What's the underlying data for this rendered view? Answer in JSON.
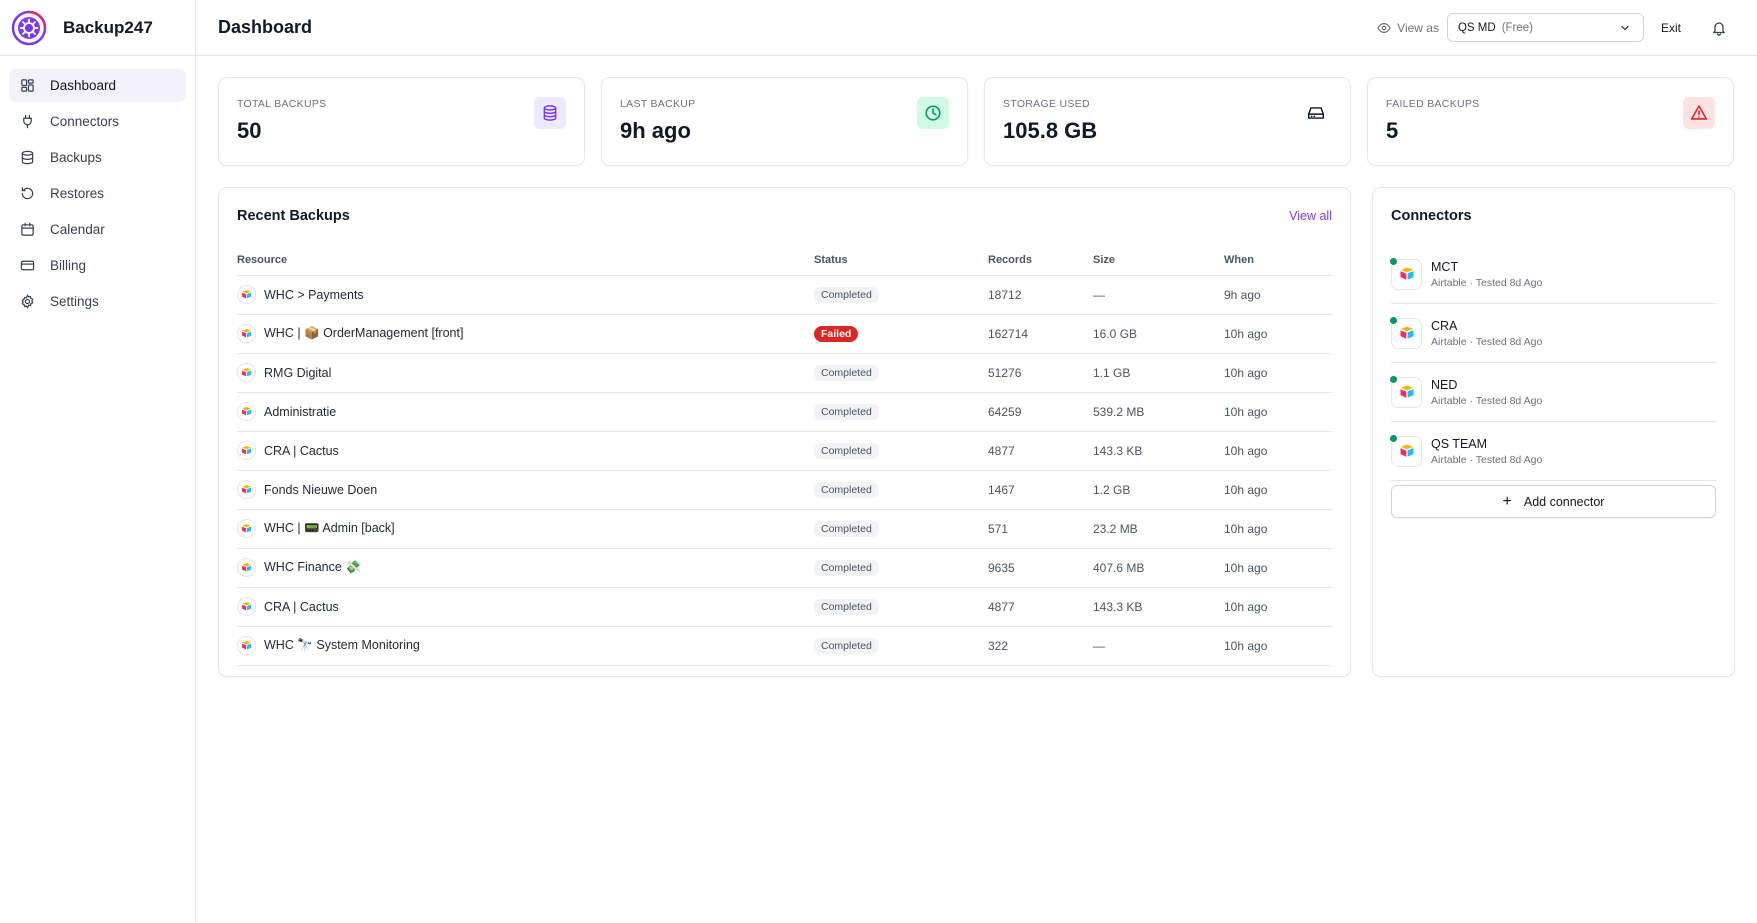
{
  "brand": {
    "name": "Backup247"
  },
  "header": {
    "title": "Dashboard",
    "view_as_label": "View as",
    "account": "QS MD",
    "plan": "(Free)",
    "exit_label": "Exit"
  },
  "sidebar": {
    "items": [
      {
        "label": "Dashboard",
        "icon": "dashboard-icon",
        "active": true
      },
      {
        "label": "Connectors",
        "icon": "plug-icon"
      },
      {
        "label": "Backups",
        "icon": "database-icon"
      },
      {
        "label": "Restores",
        "icon": "restore-icon"
      },
      {
        "label": "Calendar",
        "icon": "calendar-icon"
      },
      {
        "label": "Billing",
        "icon": "credit-card-icon"
      },
      {
        "label": "Settings",
        "icon": "gear-icon"
      }
    ]
  },
  "stats": [
    {
      "label": "TOTAL BACKUPS",
      "value": "50",
      "icon": "database-icon",
      "icon_bg": "#ede9fe",
      "icon_color": "#7c3aed"
    },
    {
      "label": "LAST BACKUP",
      "value": "9h ago",
      "icon": "clock-icon",
      "icon_bg": "#d1fae5",
      "icon_color": "#059669"
    },
    {
      "label": "STORAGE USED",
      "value": "105.8 GB",
      "icon": "hard-drive-icon",
      "icon_bg": "#ffffff",
      "icon_color": "#111827"
    },
    {
      "label": "FAILED BACKUPS",
      "value": "5",
      "icon": "warning-icon",
      "icon_bg": "#fee2e2",
      "icon_color": "#dc2626"
    }
  ],
  "recent": {
    "title": "Recent Backups",
    "view_all": "View all",
    "columns": [
      "Resource",
      "Status",
      "Records",
      "Size",
      "When"
    ],
    "rows": [
      {
        "resource": "WHC > Payments",
        "status": "Completed",
        "records": "18712",
        "size": "—",
        "when": "9h ago"
      },
      {
        "resource": "WHC | 📦 OrderManagement [front]",
        "status": "Failed",
        "records": "162714",
        "size": "16.0 GB",
        "when": "10h ago"
      },
      {
        "resource": "RMG Digital",
        "status": "Completed",
        "records": "51276",
        "size": "1.1 GB",
        "when": "10h ago"
      },
      {
        "resource": "Administratie",
        "status": "Completed",
        "records": "64259",
        "size": "539.2 MB",
        "when": "10h ago"
      },
      {
        "resource": "CRA | Cactus",
        "status": "Completed",
        "records": "4877",
        "size": "143.3 KB",
        "when": "10h ago"
      },
      {
        "resource": "Fonds Nieuwe Doen",
        "status": "Completed",
        "records": "1467",
        "size": "1.2 GB",
        "when": "10h ago"
      },
      {
        "resource": "WHC | 📟 Admin [back]",
        "status": "Completed",
        "records": "571",
        "size": "23.2 MB",
        "when": "10h ago"
      },
      {
        "resource": "WHC Finance 💸",
        "status": "Completed",
        "records": "9635",
        "size": "407.6 MB",
        "when": "10h ago"
      },
      {
        "resource": "CRA | Cactus",
        "status": "Completed",
        "records": "4877",
        "size": "143.3 KB",
        "when": "10h ago"
      },
      {
        "resource": "WHC 🔭 System Monitoring",
        "status": "Completed",
        "records": "322",
        "size": "—",
        "when": "10h ago"
      }
    ]
  },
  "connectors": {
    "title": "Connectors",
    "items": [
      {
        "name": "MCT",
        "sub": "Airtable · Tested 8d Ago"
      },
      {
        "name": "CRA",
        "sub": "Airtable · Tested 8d Ago"
      },
      {
        "name": "NED",
        "sub": "Airtable · Tested 8d Ago"
      },
      {
        "name": "QS TEAM",
        "sub": "Airtable · Tested 8d Ago"
      }
    ],
    "add_label": "Add connector"
  },
  "colors": {
    "accent": "#7c3aed",
    "active_bg": "#f3f1fb",
    "success": "#059669",
    "danger": "#dc2626"
  }
}
